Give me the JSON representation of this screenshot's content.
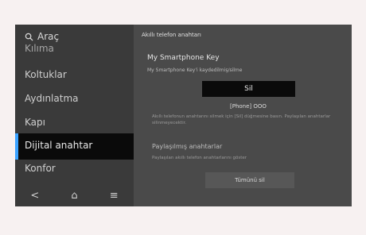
{
  "sidebar": {
    "search_label": "Araç",
    "items": [
      {
        "label": "Kılıma"
      },
      {
        "label": "Koltuklar"
      },
      {
        "label": "Aydınlatma"
      },
      {
        "label": "Kapı"
      },
      {
        "label": "Dijital anahtar"
      },
      {
        "label": "Konfor"
      }
    ]
  },
  "bottom_nav": {
    "back": "<",
    "home": "⌂",
    "menu": "≡"
  },
  "content": {
    "header": "Akıllı telefon anahtarı",
    "key_title": "My Smartphone Key",
    "key_desc": "My Smartphone Key'i kaydedilmiş/silme",
    "delete_button": "Sil",
    "phone_label": "[Phone] OOO",
    "phone_desc": "Akıllı telefonun anahtarını silmek için [Sil] düğmesine basın. Paylaşılan anahtarlar silinmeyecektir.",
    "share_title": "Paylaşılmış anahtarlar",
    "share_desc": "Paylaşılan akıllı telefon anahtarlarını göster",
    "delete_all_button": "Tümünü sil"
  },
  "colors": {
    "accent": "#3aa2ff",
    "selected_bg": "#0a0a0a",
    "panel_bg": "#4a4a4a"
  }
}
